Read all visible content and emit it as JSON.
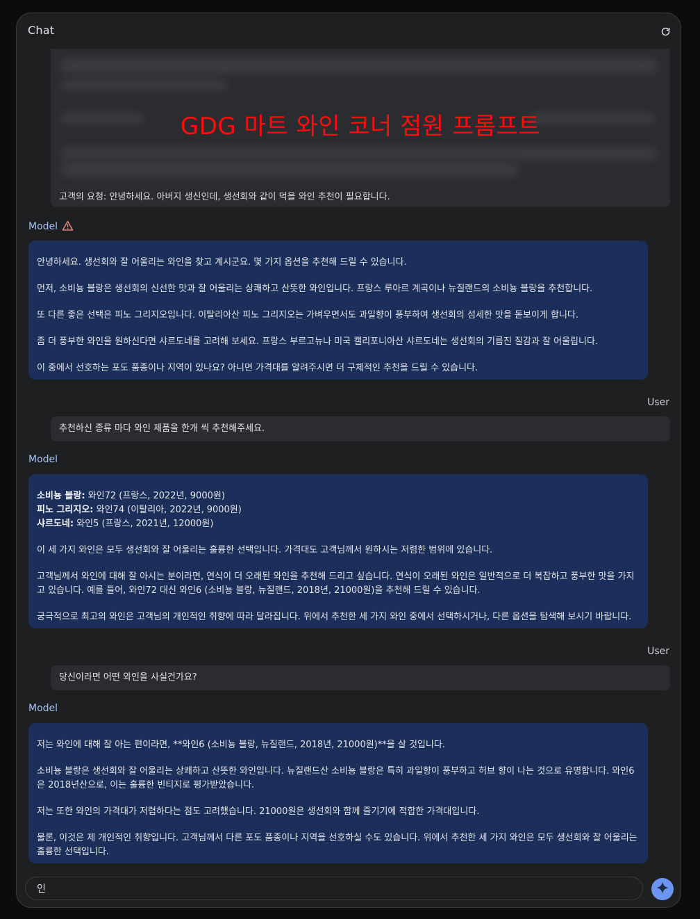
{
  "header": {
    "title": "Chat",
    "refresh_icon": "refresh-icon"
  },
  "prompt": {
    "overlay_title": "GDG 마트 와인 코너 점원 프롬프트",
    "request": "고객의 요청: 안녕하세요. 아버지 생신인데, 생선회와 같이 먹을 와인 추천이 필요합니다."
  },
  "messages": {
    "m1_label": "Model",
    "m1": [
      "안녕하세요. 생선회와 잘 어울리는 와인을 찾고 계시군요. 몇 가지 옵션을 추천해 드릴 수 있습니다.",
      "먼저, 소비뇽 블랑은 생선회의 신선한 맛과 잘 어울리는 상쾌하고 산뜻한 와인입니다. 프랑스 루아르 계곡이나 뉴질랜드의 소비뇽 블랑을 추천합니다.",
      "또 다른 좋은 선택은 피노 그리지오입니다. 이탈리아산 피노 그리지오는 가벼우면서도 과일향이 풍부하여 생선회의 섬세한 맛을 돋보이게 합니다.",
      "좀 더 풍부한 와인을 원하신다면 샤르도네를 고려해 보세요. 프랑스 부르고뉴나 미국 캘리포니아산 샤르도네는 생선회의 기름진 질감과 잘 어울립니다.",
      "이 중에서 선호하는 포도 품종이나 지역이 있나요? 아니면 가격대를 알려주시면 더 구체적인 추천을 드릴 수 있습니다."
    ],
    "u1_label": "User",
    "u1": "추천하신 종류 마다 와인 제품을 한개 씩 추천해주세요.",
    "m2_label": "Model",
    "m2_list": [
      {
        "name": "소비뇽 블랑:",
        "value": " 와인72 (프랑스, 2022년, 9000원)"
      },
      {
        "name": "피노 그리지오:",
        "value": " 와인74 (이탈리아, 2022년, 9000원)"
      },
      {
        "name": "샤르도네:",
        "value": " 와인5 (프랑스, 2021년, 12000원)"
      }
    ],
    "m2": [
      "이 세 가지 와인은 모두 생선회와 잘 어울리는 훌륭한 선택입니다. 가격대도 고객님께서 원하시는 저렴한 범위에 있습니다.",
      "고객님께서 와인에 대해 잘 아시는 분이라면, 연식이 더 오래된 와인을 추천해 드리고 싶습니다. 연식이 오래된 와인은 일반적으로 더 복잡하고 풍부한 맛을 가지\n고 있습니다. 예를 들어, 와인72 대신 와인6 (소비뇽 블랑, 뉴질랜드, 2018년, 21000원)을 추천해 드릴 수 있습니다.",
      "궁극적으로 최고의 와인은 고객님의 개인적인 취향에 따라 달라집니다. 위에서 추천한 세 가지 와인 중에서 선택하시거나, 다른 옵션을 탐색해 보시기 바랍니다."
    ],
    "u2_label": "User",
    "u2": "당신이라면 어떤 와인을 사실건가요?",
    "m3_label": "Model",
    "m3": [
      "저는 와인에 대해 잘 아는 편이라면, **와인6 (소비뇽 블랑, 뉴질랜드, 2018년, 21000원)**을 살 것입니다.",
      "소비뇽 블랑은 생선회와 잘 어울리는 상쾌하고 산뜻한 와인입니다. 뉴질랜드산 소비뇽 블랑은 특히 과일향이 풍부하고 허브 향이 나는 것으로 유명합니다. 와인6\n은 2018년산으로, 이는 훌륭한 빈티지로 평가받았습니다.",
      "저는 또한 와인의 가격대가 저렴하다는 점도 고려했습니다. 21000원은 생선회와 함께 즐기기에 적합한 가격대입니다.",
      "물론, 이것은 제 개인적인 취향입니다. 고객님께서 다른 포도 품종이나 지역을 선호하실 수도 있습니다. 위에서 추천한 세 가지 와인은 모두 생선회와 잘 어울리는\n훌륭한 선택입니다."
    ]
  },
  "composer": {
    "value": "인",
    "send_icon": "sparkle-send-icon"
  },
  "colors": {
    "model_bubble": "#1c2f5a",
    "accent": "#6b96f0",
    "overlay_red": "#ff0d0d"
  }
}
